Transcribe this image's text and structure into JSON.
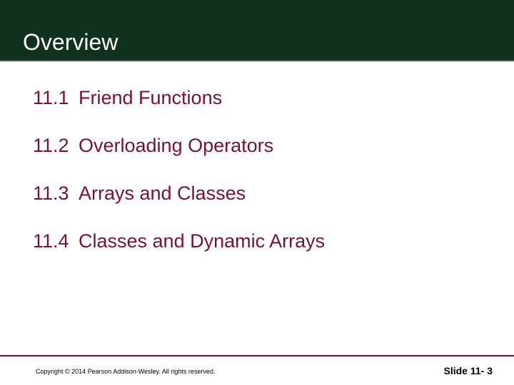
{
  "header": {
    "title": "Overview"
  },
  "items": [
    {
      "num": "11.1",
      "label": "Friend Functions"
    },
    {
      "num": "11.2",
      "label": "Overloading Operators"
    },
    {
      "num": "11.3",
      "label": "Arrays and Classes"
    },
    {
      "num": "11.4",
      "label": "Classes and Dynamic Arrays"
    }
  ],
  "footer": {
    "copyright": "Copyright © 2014 Pearson Addison-Wesley.  All rights reserved.",
    "slide_label": "Slide 11- 3"
  }
}
